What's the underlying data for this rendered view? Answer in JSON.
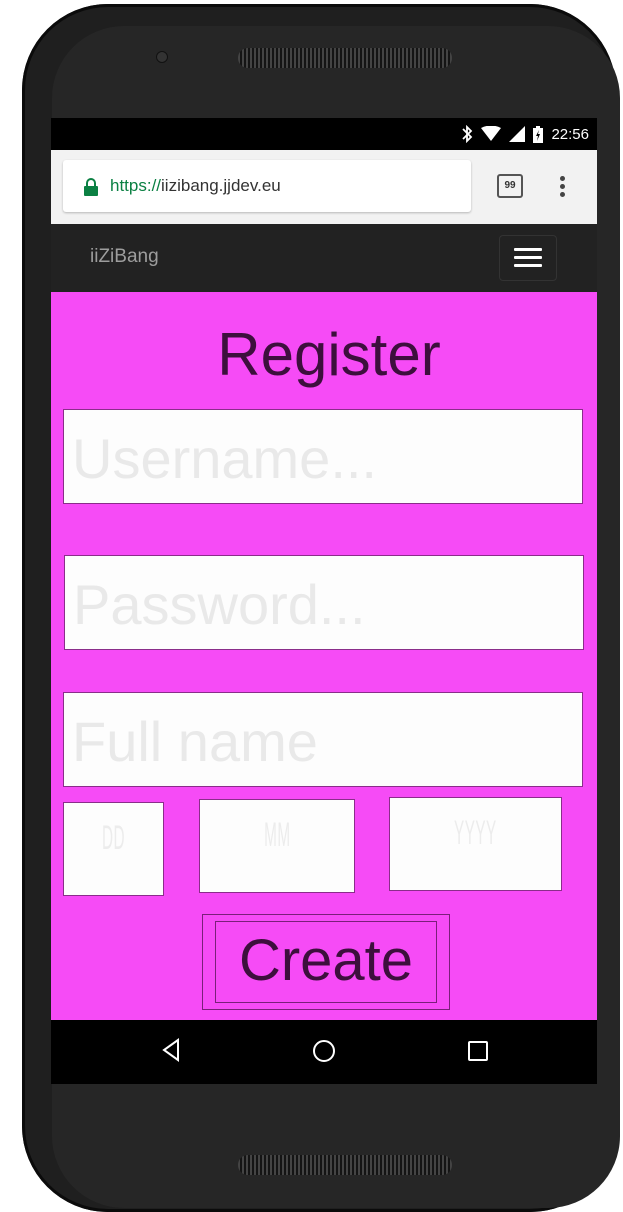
{
  "status": {
    "time": "22:56"
  },
  "browser": {
    "url_scheme": "https://",
    "url_host": "iizibang.jjdev.eu",
    "tab_count": "99"
  },
  "app": {
    "brand": "iiZiBang"
  },
  "form": {
    "title": "Register",
    "username_placeholder": "Username...",
    "password_placeholder": "Password...",
    "fullname_placeholder": "Full name",
    "day_placeholder": "DD",
    "month_placeholder": "MM",
    "year_placeholder": "YYYY",
    "create_label": "Create"
  },
  "colors": {
    "page_background": "#f64bf6",
    "navbar": "#222222",
    "url_scheme": "#0b8043"
  },
  "icons": [
    "bluetooth-icon",
    "wifi-icon",
    "signal-icon",
    "battery-icon",
    "lock-icon",
    "hamburger-menu-icon",
    "back-icon",
    "home-icon",
    "recents-icon"
  ]
}
